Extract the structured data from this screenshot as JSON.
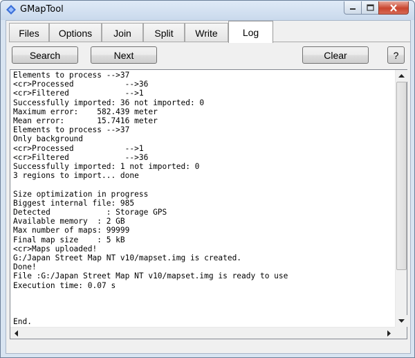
{
  "window": {
    "title": "GMapTool",
    "icon": "gmaptool-app-icon",
    "controls": [
      "minimize-icon",
      "maximize-icon",
      "close-icon"
    ]
  },
  "tabs": [
    {
      "label": "Files",
      "active": false
    },
    {
      "label": "Options",
      "active": false
    },
    {
      "label": "Join",
      "active": false
    },
    {
      "label": "Split",
      "active": false
    },
    {
      "label": "Write",
      "active": false
    },
    {
      "label": "Log",
      "active": true
    }
  ],
  "toolbar": {
    "search_label": "Search",
    "next_label": "Next",
    "clear_label": "Clear",
    "help_label": "?"
  },
  "log": {
    "text": "Elements to process -->37\n<cr>Processed           -->36\n<cr>Filtered            -->1\nSuccessfully imported: 36 not imported: 0\nMaximum error:    582.439 meter\nMean error:       15.7416 meter\nElements to process -->37\nOnly background\n<cr>Processed           -->1\n<cr>Filtered            -->36\nSuccessfully imported: 1 not imported: 0\n3 regions to import... done\n\nSize optimization in progress\nBiggest internal file: 985\nDetected            : Storage GPS\nAvailable memory  : 2 GB\nMax number of maps: 99999\nFinal map size    : 5 kB\n<cr>Maps uploaded!\nG:/Japan Street Map NT v10/mapset.img is created.\nDone!\nFile :G:/Japan Street Map NT v10/mapset.img is ready to use\nExecution time: 0.07 s\n\n\n\nEnd."
  },
  "colors": {
    "frame": "#d8e4f1",
    "close_button": "#c9452e",
    "client_bg": "#f0f0f0"
  }
}
